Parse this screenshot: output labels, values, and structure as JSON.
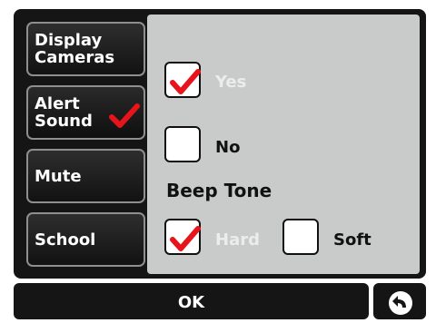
{
  "sidebar": {
    "items": [
      {
        "label": "Display\nCameras",
        "selected": false
      },
      {
        "label": "Alert\nSound",
        "selected": true,
        "icon": "checkmark-icon"
      },
      {
        "label": "Mute",
        "selected": false
      },
      {
        "label": "School",
        "selected": false
      }
    ]
  },
  "alert_sound": {
    "yes_label": "Yes",
    "yes_checked": true,
    "no_label": "No",
    "no_checked": false
  },
  "beep_tone": {
    "heading": "Beep Tone",
    "hard_label": "Hard",
    "hard_checked": true,
    "soft_label": "Soft",
    "soft_checked": false
  },
  "footer": {
    "ok_label": "OK",
    "back_icon": "back-arrow-icon"
  },
  "colors": {
    "checkmark": "#e8141c",
    "panel": "#c9cbcb",
    "button": "#151515"
  }
}
